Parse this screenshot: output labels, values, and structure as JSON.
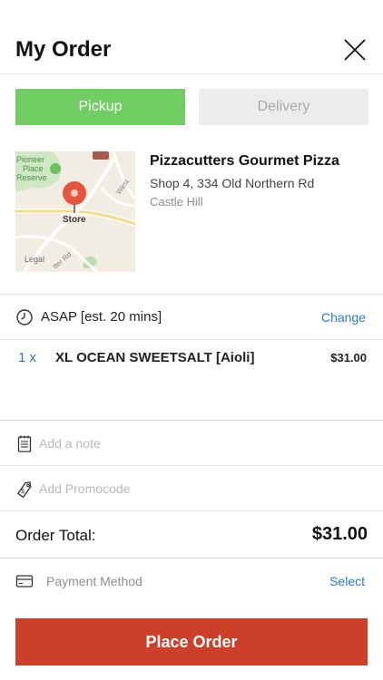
{
  "header": {
    "title": "My Order"
  },
  "mode": {
    "pickup_label": "Pickup",
    "delivery_label": "Delivery",
    "selected": "Pickup"
  },
  "store": {
    "name": "Pizzacutters Gourmet Pizza",
    "address": "Shop 4, 334 Old Northern Rd",
    "suburb": "Castle Hill",
    "map": {
      "labels": {
        "park": "Pioneer\nPlace\nReserve",
        "pin": "Store",
        "legal": "Legal",
        "road1": "West",
        "road2": "tter Rd"
      }
    }
  },
  "time": {
    "text": "ASAP [est. 20 mins]",
    "change_label": "Change"
  },
  "items": [
    {
      "qty": "1 x",
      "name": "XL OCEAN SWEETSALT [Aioli]",
      "price": "$31.00"
    }
  ],
  "note": {
    "placeholder": "Add a note"
  },
  "promo": {
    "placeholder": "Add Promocode"
  },
  "total": {
    "label": "Order Total:",
    "value": "$31.00"
  },
  "payment": {
    "label": "Payment Method",
    "select_label": "Select"
  },
  "place_order": {
    "label": "Place Order"
  },
  "colors": {
    "pickup": "#70cd62",
    "delivery": "#ececec",
    "link": "#2b7bc7",
    "primary_button": "#cc3f28",
    "map_pin": "#e8553f"
  },
  "icons": [
    "close-icon",
    "clock-icon",
    "notepad-icon",
    "promo-tag-icon",
    "credit-card-icon",
    "map-pin-icon",
    "park-tree-icon",
    "fuel-icon"
  ]
}
